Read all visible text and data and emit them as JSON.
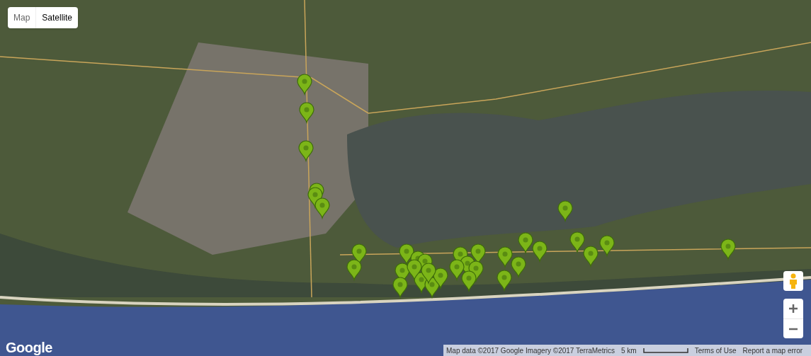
{
  "map_type_control": [
    {
      "label": "Map",
      "selected": false
    },
    {
      "label": "Satellite",
      "selected": true
    }
  ],
  "logo": "Google",
  "footer": {
    "attribution": "Map data ©2017 Google Imagery ©2017 TerraMetrics",
    "scale": "5 km",
    "links": [
      "Terms of Use",
      "Report a map error"
    ]
  }
}
